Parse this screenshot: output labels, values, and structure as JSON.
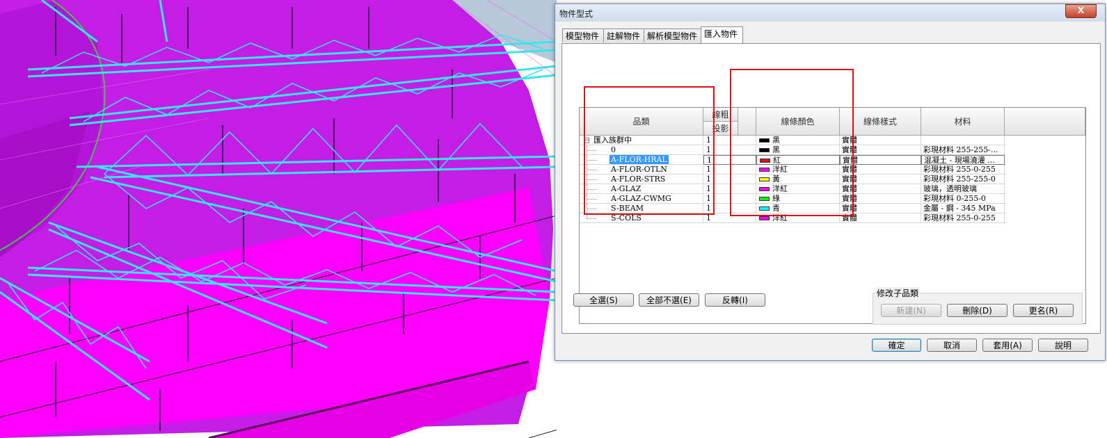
{
  "dialog": {
    "title": "物件型式",
    "close_label": "X",
    "tabs": [
      "模型物件",
      "註解物件",
      "解析模型物件",
      "匯入物件"
    ],
    "active_tab": "匯入物件"
  },
  "grid": {
    "headers": {
      "category": "品類",
      "line_weight": "線粗",
      "projection": "投影",
      "line_color": "線條顏色",
      "line_pattern": "線條樣式",
      "material": "材料"
    },
    "rows": [
      {
        "name": "匯入族群中",
        "weight": "1",
        "color_name": "黑",
        "color": "#000000",
        "pattern": "實體",
        "material": ""
      },
      {
        "name": "0",
        "weight": "1",
        "color_name": "黑",
        "color": "#000000",
        "pattern": "實體",
        "material": "彩現材料 255-255-..."
      },
      {
        "name": "A-FLOR-HRAL",
        "weight": "1",
        "color_name": "紅",
        "color": "#e01010",
        "pattern": "實體",
        "material": "混凝土 - 現場澆灌 ..."
      },
      {
        "name": "A-FLOR-OTLN",
        "weight": "1",
        "color_name": "洋紅",
        "color": "#ff00ff",
        "pattern": "實體",
        "material": "彩現材料 255-0-255"
      },
      {
        "name": "A-FLOR-STRS",
        "weight": "1",
        "color_name": "黃",
        "color": "#ffff00",
        "pattern": "實體",
        "material": "彩現材料 255-255-0"
      },
      {
        "name": "A-GLAZ",
        "weight": "1",
        "color_name": "洋紅",
        "color": "#ff00ff",
        "pattern": "實體",
        "material": "玻璃，透明玻璃"
      },
      {
        "name": "A-GLAZ-CWMG",
        "weight": "1",
        "color_name": "綠",
        "color": "#00ff00",
        "pattern": "實體",
        "material": "彩現材料 0-255-0"
      },
      {
        "name": "S-BEAM",
        "weight": "1",
        "color_name": "青",
        "color": "#00ffff",
        "pattern": "實體",
        "material": "金屬 - 鋼 - 345 MPa"
      },
      {
        "name": "S-COLS",
        "weight": "1",
        "color_name": "洋紅",
        "color": "#ff00ff",
        "pattern": "實體",
        "material": "彩現材料 255-0-255"
      }
    ]
  },
  "buttons": {
    "select_all": "全選(S)",
    "select_none": "全部不選(E)",
    "invert": "反轉(I)",
    "modify_subcategories": "修改子品類",
    "new": "新建(N)",
    "delete": "刪除(D)",
    "rename": "更名(R)",
    "ok": "確定",
    "cancel": "取消",
    "apply": "套用(A)",
    "help": "說明"
  },
  "colors": {
    "viewport_magenta": "#c81ee8",
    "viewport_floor": "#ff00ff",
    "truss_cyan": "#33e6f0",
    "annotation_red": "#e01010",
    "selection_blue": "#3399ff"
  }
}
